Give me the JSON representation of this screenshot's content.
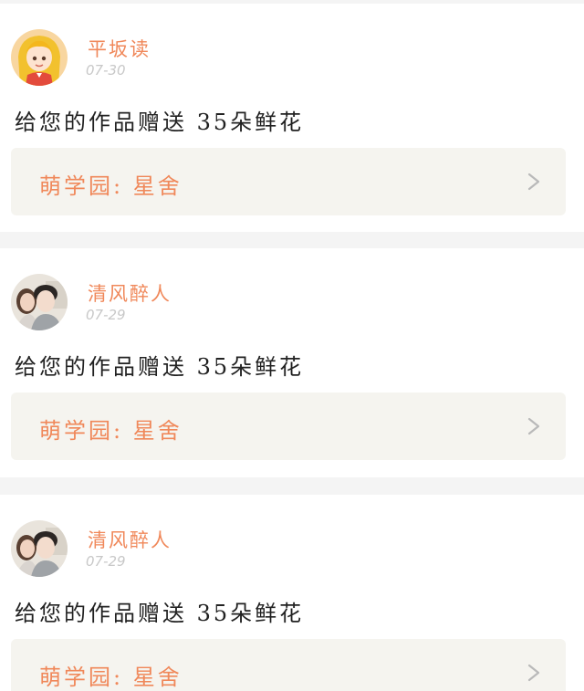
{
  "posts": [
    {
      "username": "平坂读",
      "date": "07-30",
      "message": "给您的作品赠送 35朵鲜花",
      "link_label": "萌学园: 星舍",
      "avatar_icon": "anime-girl-avatar-icon"
    },
    {
      "username": "清风醉人",
      "date": "07-29",
      "message": "给您的作品赠送 35朵鲜花",
      "link_label": "萌学园: 星舍",
      "avatar_icon": "couple-photo-avatar-icon"
    },
    {
      "username": "清风醉人",
      "date": "07-29",
      "message": "给您的作品赠送 35朵鲜花",
      "link_label": "萌学园: 星舍",
      "avatar_icon": "couple-photo-avatar-icon"
    }
  ],
  "colors": {
    "accent": "#f0885a",
    "link_bg": "#f5f4ef",
    "date": "#c8c8c8",
    "separator": "#f4f4f4"
  }
}
